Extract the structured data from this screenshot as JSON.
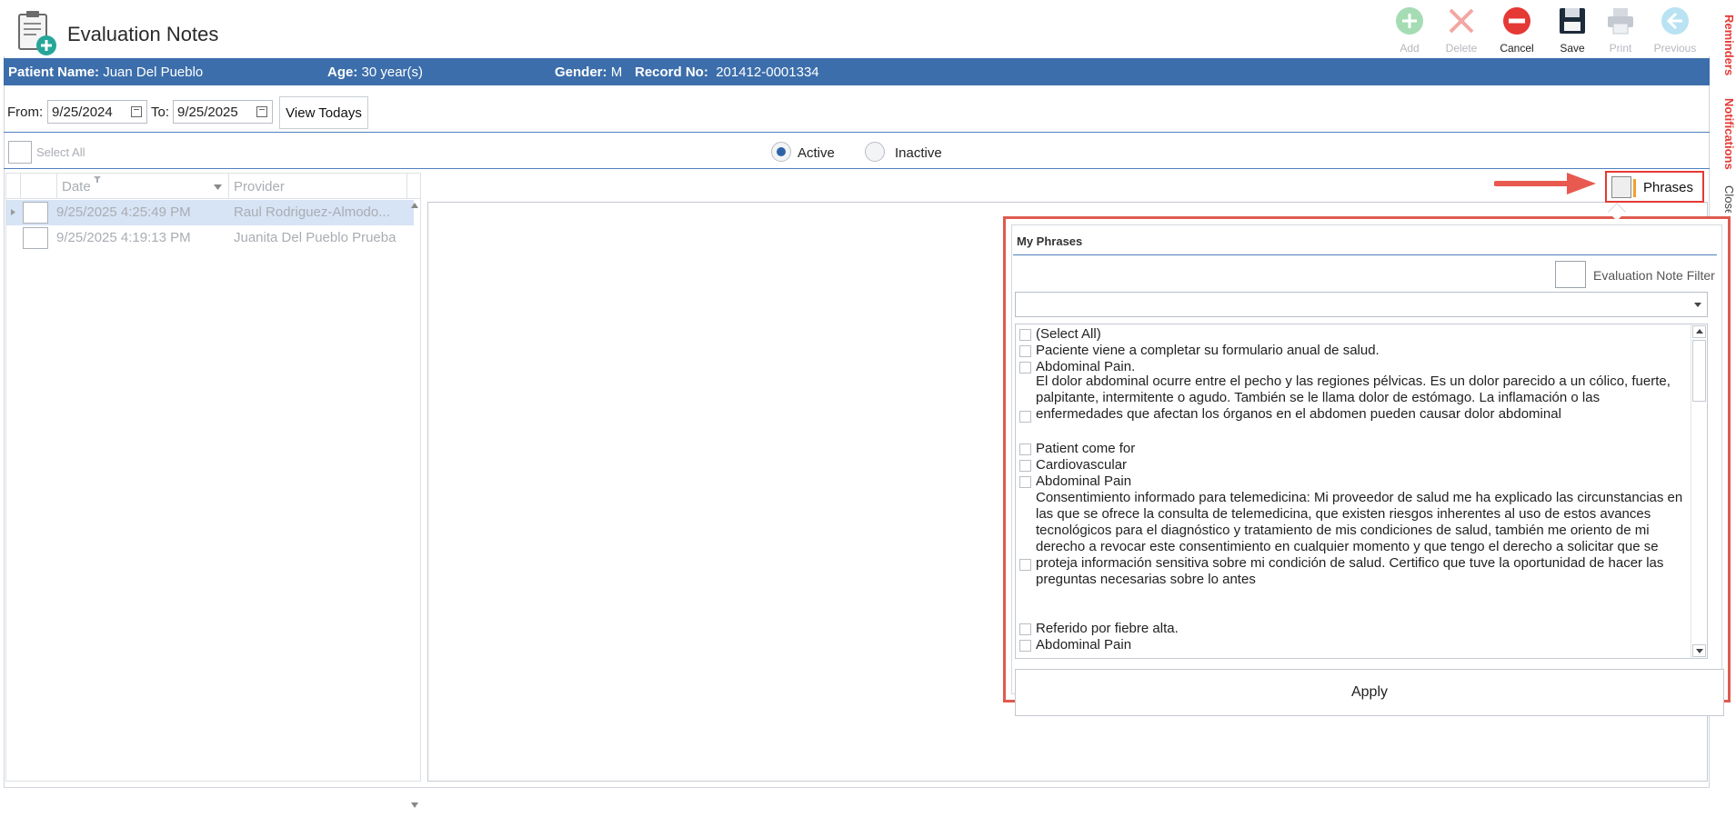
{
  "app": {
    "title": "Evaluation Notes"
  },
  "toolbar": {
    "add_label": "Add",
    "delete_label": "Delete",
    "cancel_label": "Cancel",
    "save_label": "Save",
    "print_label": "Print",
    "previous_label": "Previous"
  },
  "side_tabs": {
    "reminders": "Reminders",
    "notifications": "Notifications",
    "close": "Close"
  },
  "patient": {
    "name_label": "Patient Name:",
    "name": "Juan Del Pueblo",
    "age_label": "Age:",
    "age": "30 year(s)",
    "gender_label": "Gender:",
    "gender": "M",
    "record_label": "Record No:",
    "record": "201412-0001334"
  },
  "filter": {
    "from_label": "From:",
    "from_value": "9/25/2024",
    "to_label": "To:",
    "to_value": "9/25/2025",
    "view_todays_label": "View Todays"
  },
  "selection": {
    "select_all_label": "Select All",
    "active_label": "Active",
    "inactive_label": "Inactive",
    "active_selected": true
  },
  "grid": {
    "columns": [
      "Date",
      "Provider"
    ],
    "rows": [
      {
        "date": "9/25/2025 4:25:49 PM",
        "provider": "Raul Rodriguez-Almodo...",
        "selected": true
      },
      {
        "date": "9/25/2025 4:19:13 PM",
        "provider": "Juanita Del Pueblo Prueba",
        "selected": false
      }
    ]
  },
  "phrases_button": {
    "label": "Phrases"
  },
  "phrases_popup": {
    "title": "My Phrases",
    "filter_label": "Evaluation Note Filter",
    "combo_value": "",
    "items": [
      "(Select All)",
      " Paciente viene a completar su formulario anual de salud.",
      "Abdominal Pain.",
      "El dolor abdominal ocurre entre el pecho y las regiones pélvicas. Es un dolor parecido a un cólico, fuerte, palpitante, intermitente o agudo. También se le llama dolor de estómago. La inflamación o las enfermedades que afectan los órganos en el abdomen pueden causar dolor abdominal",
      "Patient come for",
      "Cardiovascular",
      "Abdominal Pain",
      "Consentimiento informado para telemedicina:  Mi proveedor de salud me ha explicado las circunstancias en las que se ofrece la consulta de telemedicina, que existen riesgos inherentes al uso de estos avances tecnológicos para el diagnóstico y tratamiento de mis condiciones de salud, también me oriento de mi derecho a revocar este consentimiento en cualquier momento y que tengo el derecho a solicitar que se proteja información sensitiva sobre mi condición de salud.  Certifico que tuve la oportunidad de hacer las preguntas necesarias sobre lo antes",
      "Referido por fiebre alta.",
      "Abdominal Pain"
    ],
    "apply_label": "Apply"
  },
  "colors": {
    "banner": "#3c6eab",
    "highlight": "#e53935",
    "accent": "#2e63a7"
  }
}
